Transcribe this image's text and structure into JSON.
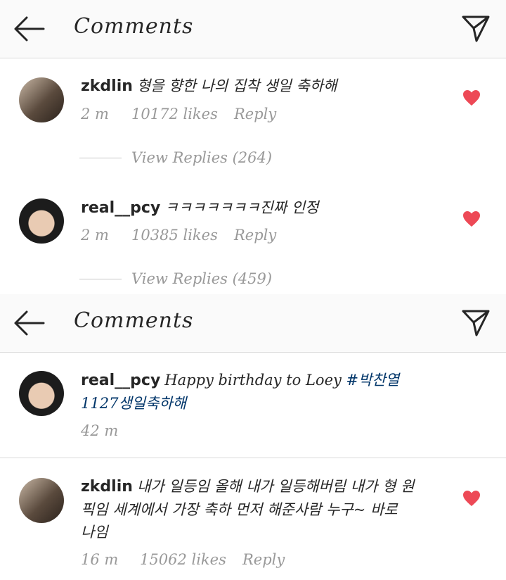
{
  "panel_a": {
    "header": {
      "title": "Comments"
    },
    "comments": [
      {
        "username": "zkdlin",
        "text": "형을 향한 나의 집착 생일 축하해",
        "time": "2 m",
        "likes": "10172 likes",
        "reply": "Reply",
        "view_replies": "View Replies (264)"
      },
      {
        "username": "real__pcy",
        "text": "ㅋㅋㅋㅋㅋㅋㅋ진짜 인정",
        "time": "2 m",
        "likes": "10385 likes",
        "reply": "Reply",
        "view_replies": "View Replies (459)"
      }
    ]
  },
  "panel_b": {
    "header": {
      "title": "Comments"
    },
    "comments": [
      {
        "username": "real__pcy",
        "text": "Happy birthday to Loey",
        "hashtag": "#박찬열1127생일축하해",
        "time": "42 m"
      },
      {
        "username": "zkdlin",
        "text": "내가 일등임 올해 내가 일등해버림 내가 형 원픽임 세계에서 가장 축하 먼저 해준사람 누구~ 바로 나임",
        "time": "16 m",
        "likes": "15062 likes",
        "reply": "Reply"
      }
    ]
  },
  "colors": {
    "heart": "#ed4956",
    "hashtag": "#003569",
    "meta": "#999999"
  },
  "icons": {
    "back": "arrow-left-icon",
    "send": "paper-plane-icon",
    "like": "heart-icon"
  }
}
